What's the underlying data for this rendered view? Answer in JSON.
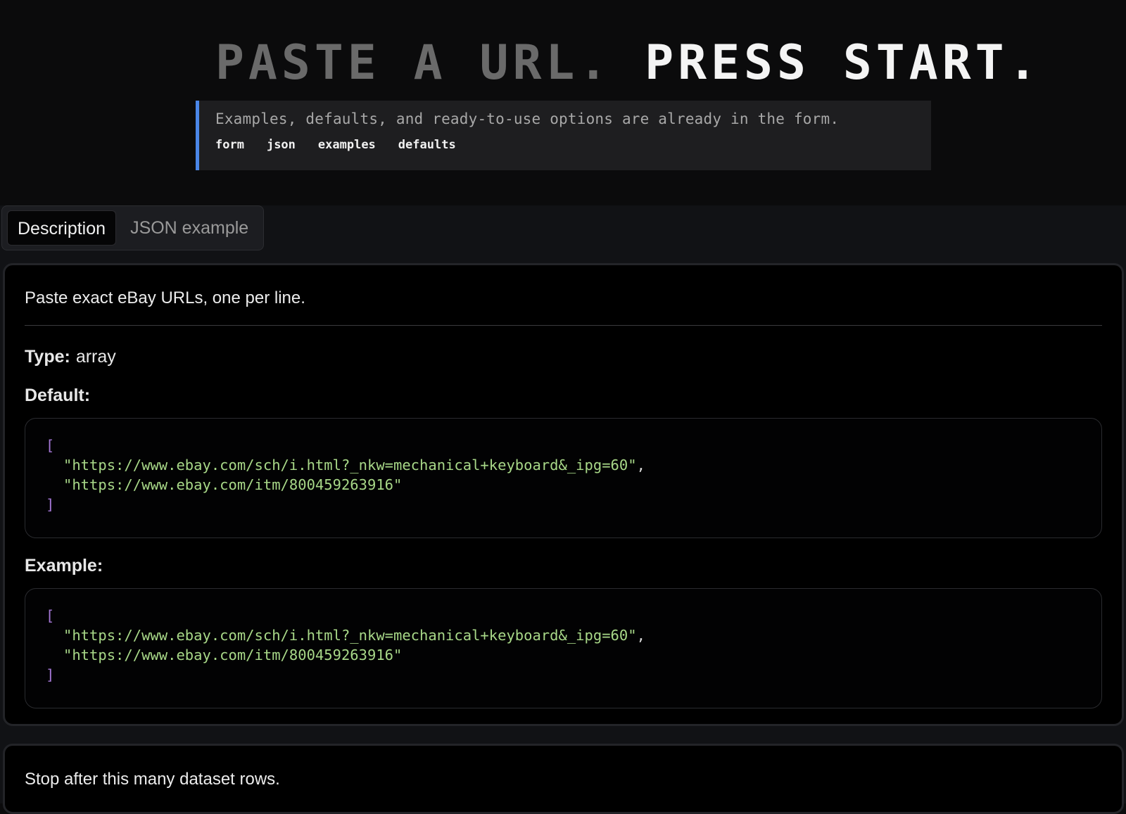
{
  "hero": {
    "title_dim": "PASTE A URL.",
    "title_bright": "PRESS START.",
    "callout_text": "Examples, defaults, and ready-to-use options are already in the form.",
    "tags": [
      "form",
      "json",
      "examples",
      "defaults"
    ]
  },
  "tabs": [
    {
      "label": "Description",
      "active": true
    },
    {
      "label": "JSON example",
      "active": false
    }
  ],
  "field1": {
    "description": "Paste exact eBay URLs, one per line.",
    "type_key": "Type:",
    "type_value": "array",
    "default_label": "Default:",
    "example_label": "Example:",
    "open_bracket": "[",
    "close_bracket": "]",
    "default_values": [
      "\"https://www.ebay.com/sch/i.html?_nkw=mechanical+keyboard&_ipg=60\"",
      "\"https://www.ebay.com/itm/800459263916\""
    ],
    "example_values": [
      "\"https://www.ebay.com/sch/i.html?_nkw=mechanical+keyboard&_ipg=60\"",
      "\"https://www.ebay.com/itm/800459263916\""
    ],
    "comma": ","
  },
  "field2": {
    "description": "Stop after this many dataset rows."
  },
  "colors": {
    "accent": "#4a86e8",
    "bracket": "#a678d8",
    "string": "#a8d888"
  }
}
